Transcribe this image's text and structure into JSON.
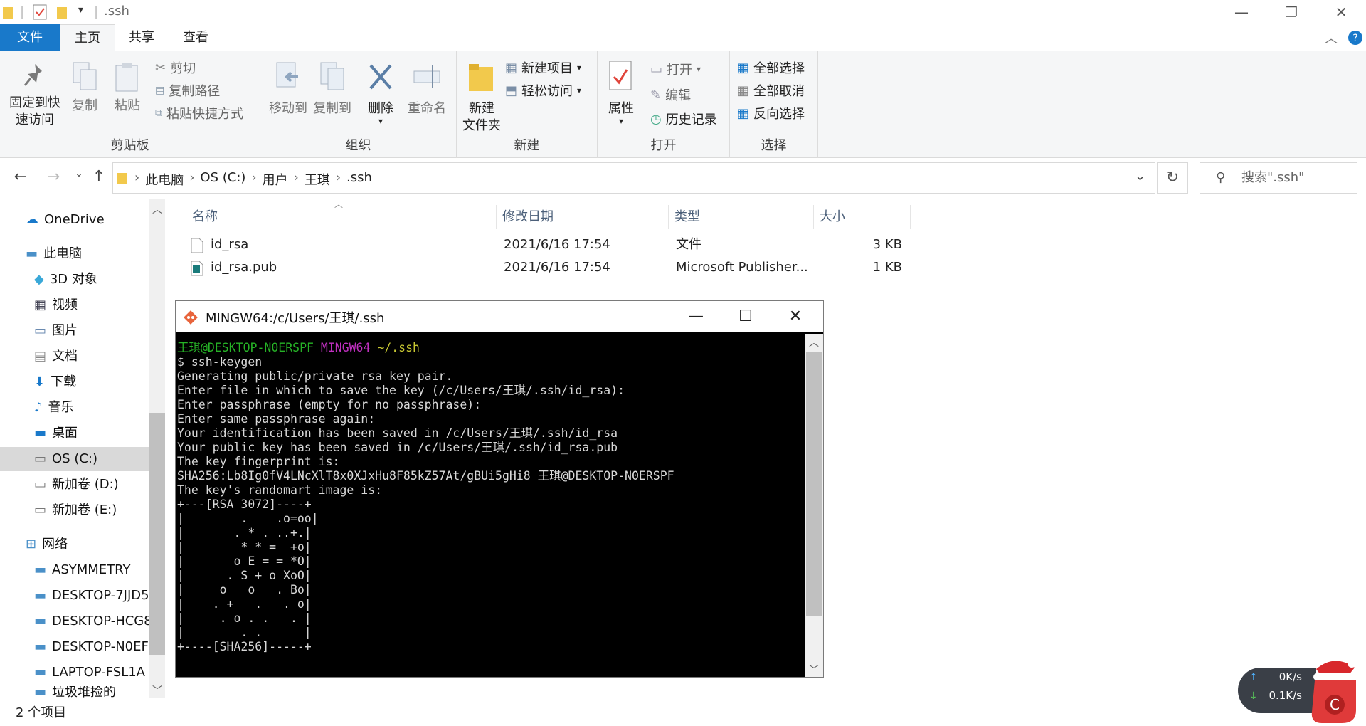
{
  "window": {
    "title": ".ssh"
  },
  "tabs": {
    "file": "文件",
    "home": "主页",
    "share": "共享",
    "view": "查看"
  },
  "ribbon": {
    "clipboard": {
      "label": "剪贴板",
      "pin": "固定到快速访问",
      "copy": "复制",
      "paste": "粘贴",
      "cut": "剪切",
      "copy_path": "复制路径",
      "paste_shortcut": "粘贴快捷方式"
    },
    "organize": {
      "label": "组织",
      "move_to": "移动到",
      "copy_to": "复制到",
      "delete": "删除",
      "rename": "重命名"
    },
    "new": {
      "label": "新建",
      "new_folder": "新建\n文件夹",
      "new_item": "新建项目",
      "easy_access": "轻松访问"
    },
    "open": {
      "label": "打开",
      "properties": "属性",
      "open": "打开",
      "edit": "编辑",
      "history": "历史记录"
    },
    "select": {
      "label": "选择",
      "select_all": "全部选择",
      "select_none": "全部取消",
      "invert": "反向选择"
    }
  },
  "address": {
    "crumbs": [
      "此电脑",
      "OS (C:)",
      "用户",
      "王琪",
      ".ssh"
    ],
    "search_placeholder": "搜索\".ssh\""
  },
  "nav": {
    "items": [
      {
        "label": "OneDrive",
        "icon": "cloud-icon"
      },
      {
        "label": "此电脑",
        "icon": "computer-icon"
      },
      {
        "label": "3D 对象",
        "icon": "cube-icon"
      },
      {
        "label": "视频",
        "icon": "film-icon"
      },
      {
        "label": "图片",
        "icon": "picture-icon"
      },
      {
        "label": "文档",
        "icon": "document-icon"
      },
      {
        "label": "下载",
        "icon": "download-icon"
      },
      {
        "label": "音乐",
        "icon": "music-icon"
      },
      {
        "label": "桌面",
        "icon": "desktop-icon"
      },
      {
        "label": "OS (C:)",
        "icon": "drive-icon"
      },
      {
        "label": "新加卷 (D:)",
        "icon": "drive-icon"
      },
      {
        "label": "新加卷 (E:)",
        "icon": "drive-icon"
      },
      {
        "label": "网络",
        "icon": "network-icon"
      },
      {
        "label": "ASYMMETRY",
        "icon": "pc-icon"
      },
      {
        "label": "DESKTOP-7JJD5",
        "icon": "pc-icon"
      },
      {
        "label": "DESKTOP-HCG8",
        "icon": "pc-icon"
      },
      {
        "label": "DESKTOP-N0EF",
        "icon": "pc-icon"
      },
      {
        "label": "LAPTOP-FSL1A",
        "icon": "pc-icon"
      },
      {
        "label": "垃圾堆捡的",
        "icon": "pc-icon"
      }
    ]
  },
  "columns": {
    "name": "名称",
    "date": "修改日期",
    "type": "类型",
    "size": "大小"
  },
  "files": [
    {
      "name": "id_rsa",
      "date": "2021/6/16 17:54",
      "type": "文件",
      "size": "3 KB"
    },
    {
      "name": "id_rsa.pub",
      "date": "2021/6/16 17:54",
      "type": "Microsoft Publisher...",
      "size": "1 KB"
    }
  ],
  "status": {
    "count": "2 个项目"
  },
  "terminal": {
    "title": "MINGW64:/c/Users/王琪/.ssh",
    "prompt_user": "王琪@DESKTOP-N0ERSPF",
    "prompt_env": "MINGW64",
    "prompt_path": "~/.ssh",
    "lines": [
      "$ ssh-keygen",
      "Generating public/private rsa key pair.",
      "Enter file in which to save the key (/c/Users/王琪/.ssh/id_rsa):",
      "Enter passphrase (empty for no passphrase):",
      "Enter same passphrase again:",
      "Your identification has been saved in /c/Users/王琪/.ssh/id_rsa",
      "Your public key has been saved in /c/Users/王琪/.ssh/id_rsa.pub",
      "The key fingerprint is:",
      "SHA256:Lb8Ig0fV4LNcXlT8x0XJxHu8F85kZ57At/gBUi5gHi8 王琪@DESKTOP-N0ERSPF",
      "The key's randomart image is:",
      "+---[RSA 3072]----+",
      "|        .    .o=oo|",
      "|       . * . ..+.|",
      "|        * * =  +o|",
      "|       o E = = *O|",
      "|      . S + o XoO|",
      "|     o   o   . Bo|",
      "|    . +   .   . o|",
      "|     . o . .   . |",
      "|        . .      |",
      "+----[SHA256]-----+"
    ]
  },
  "netwidget": {
    "up": "0K/s",
    "down": "0.1K/s"
  },
  "colors": {
    "accent": "#1979ca",
    "term_green": "#26b226",
    "term_magenta": "#c030c0",
    "term_yellow": "#c8c832"
  }
}
